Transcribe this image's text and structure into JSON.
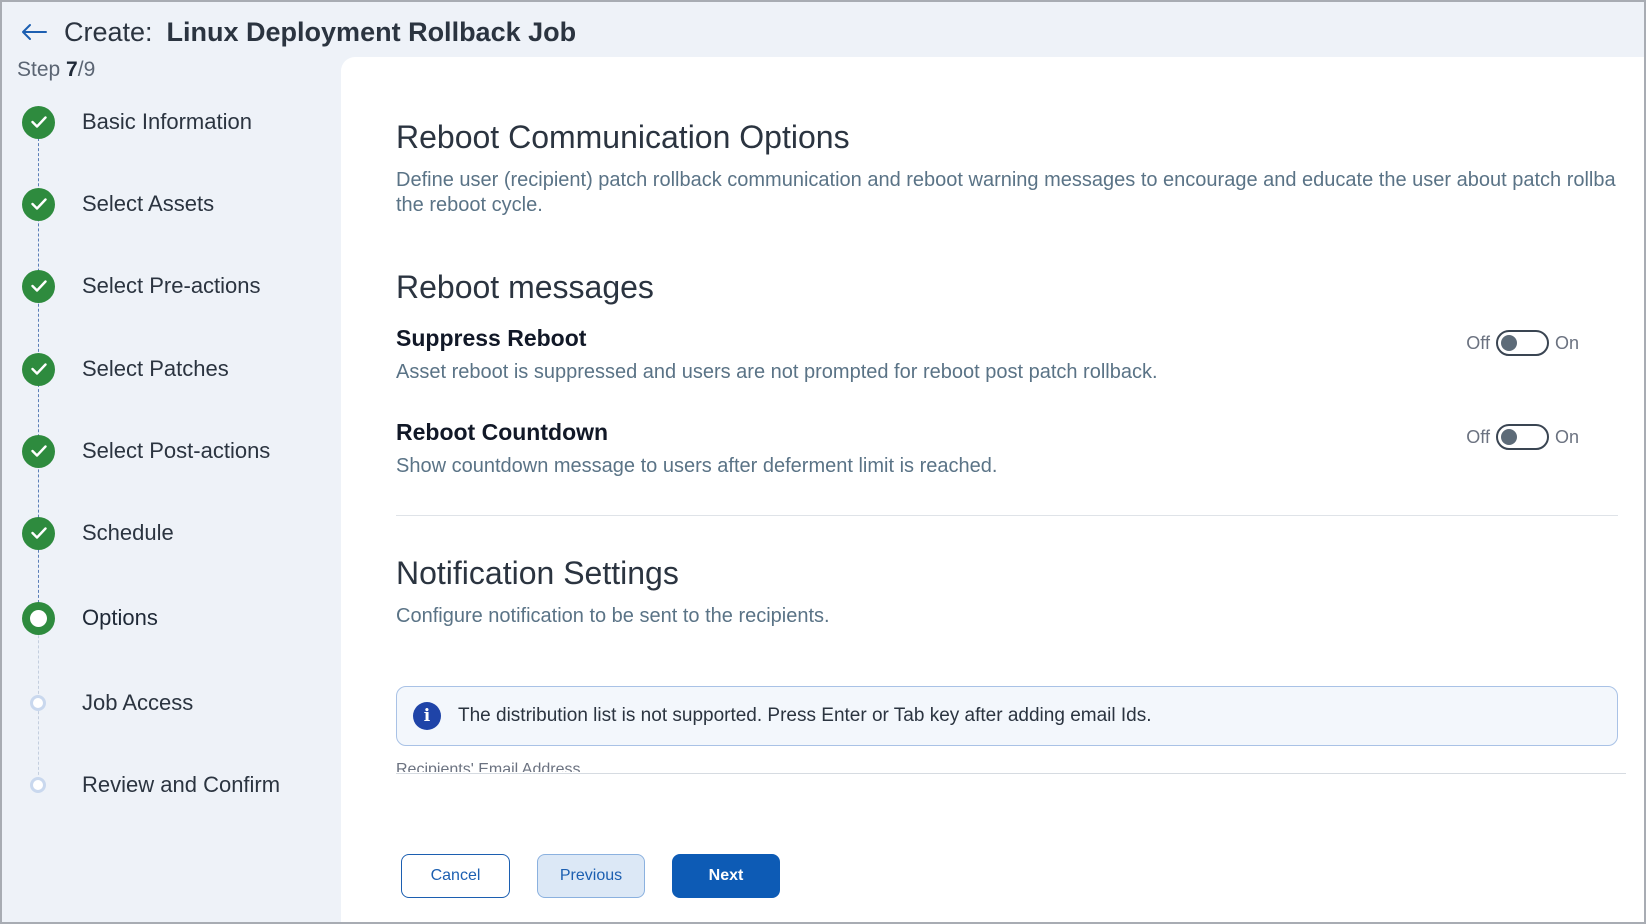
{
  "header": {
    "title_prefix": "Create:",
    "title_name": "Linux Deployment Rollback Job"
  },
  "step_counter": {
    "label": "Step",
    "current": "7",
    "total": "/9"
  },
  "steps": [
    {
      "label": "Basic Information",
      "status": "done"
    },
    {
      "label": "Select Assets",
      "status": "done"
    },
    {
      "label": "Select Pre-actions",
      "status": "done"
    },
    {
      "label": "Select Patches",
      "status": "done"
    },
    {
      "label": "Select Post-actions",
      "status": "done"
    },
    {
      "label": "Schedule",
      "status": "done"
    },
    {
      "label": "Options",
      "status": "current"
    },
    {
      "label": "Job Access",
      "status": "pending"
    },
    {
      "label": "Review and Confirm",
      "status": "pending"
    }
  ],
  "main": {
    "communication": {
      "title": "Reboot Communication Options",
      "description_line1": "Define user (recipient) patch rollback communication and reboot warning messages to encourage and educate the user about patch rollba",
      "description_line2": "the reboot cycle."
    },
    "reboot_messages": {
      "title": "Reboot messages",
      "suppress_reboot": {
        "title": "Suppress Reboot",
        "description": "Asset reboot is suppressed and users are not prompted for reboot post patch rollback.",
        "off_label": "Off",
        "on_label": "On",
        "state": "off"
      },
      "reboot_countdown": {
        "title": "Reboot Countdown",
        "description": "Show countdown message to users after deferment limit is reached.",
        "off_label": "Off",
        "on_label": "On",
        "state": "off"
      }
    },
    "notification": {
      "title": "Notification Settings",
      "description": "Configure notification to be sent to the recipients.",
      "info_message": "The distribution list is not supported. Press Enter or Tab key after adding email Ids.",
      "recipients_label": "Recipients' Email Address"
    }
  },
  "footer": {
    "cancel_label": "Cancel",
    "previous_label": "Previous",
    "next_label": "Next"
  },
  "colors": {
    "done": "#2e8b3e",
    "primary": "#0d5bb5",
    "info_icon": "#1f44a8"
  }
}
